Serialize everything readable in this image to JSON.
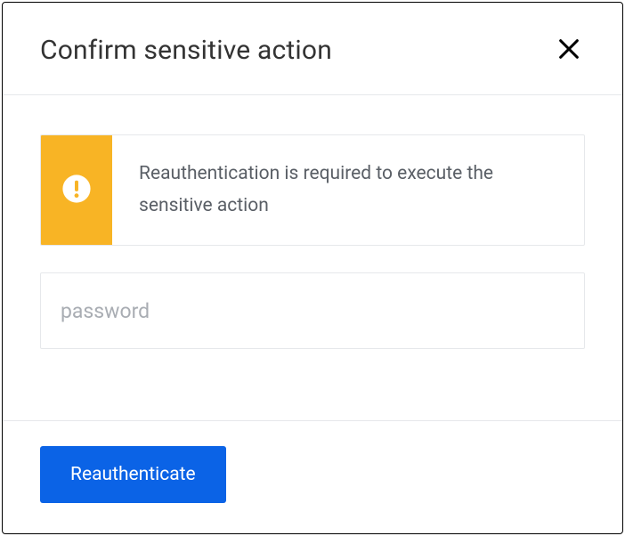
{
  "dialog": {
    "title": "Confirm sensitive action",
    "close_icon": "close",
    "alert": {
      "icon": "exclamation-circle",
      "message": "Reauthentication is required to execute the sensitive action"
    },
    "password": {
      "placeholder": "password",
      "value": ""
    },
    "submit_label": "Reauthenticate",
    "colors": {
      "alert_accent": "#f8b425",
      "primary": "#0b63e6"
    }
  }
}
